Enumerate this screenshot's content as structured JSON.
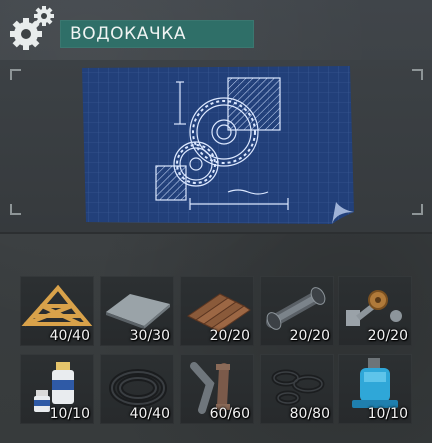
{
  "header": {
    "title": "ВОДОКАЧКА",
    "icon": "gears-icon",
    "accent_color": "#2f6f68"
  },
  "preview": {
    "image": "blueprint-water-pump",
    "blueprint_color": "#1f3a6b"
  },
  "materials": [
    {
      "icon": "wooden-frame-icon",
      "count": "40/40"
    },
    {
      "icon": "metal-sheet-icon",
      "count": "30/30"
    },
    {
      "icon": "roof-tiles-icon",
      "count": "20/20"
    },
    {
      "icon": "metal-pipe-icon",
      "count": "20/20"
    },
    {
      "icon": "gear-mechanism-icon",
      "count": "20/20"
    },
    {
      "icon": "resin-bottles-icon",
      "count": "10/10"
    },
    {
      "icon": "rubber-hose-icon",
      "count": "40/40"
    },
    {
      "icon": "pipe-fittings-icon",
      "count": "60/60"
    },
    {
      "icon": "rubber-gaskets-icon",
      "count": "80/80"
    },
    {
      "icon": "water-pump-icon",
      "count": "10/10"
    }
  ]
}
